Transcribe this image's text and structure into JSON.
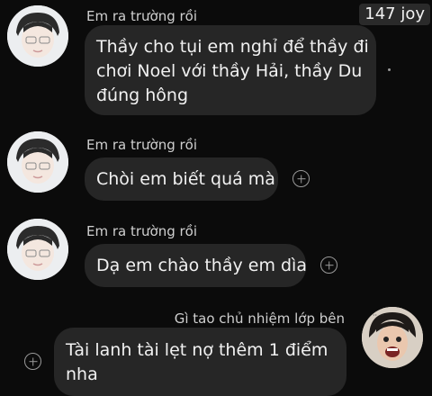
{
  "badge": {
    "text": "147 joy"
  },
  "messages": [
    {
      "sender": "Em ra trường rồi",
      "lines": [
        "Thầy cho tụi em nghỉ để thầy đi",
        "chơi Noel với thầy Hải, thầy Du",
        "đúng hông"
      ]
    },
    {
      "sender": "Em ra trường rồi",
      "lines": [
        "Chòi em biết quá mà"
      ]
    },
    {
      "sender": "Em ra trường rồi",
      "lines": [
        "Dạ em chào thầy em dìa"
      ]
    },
    {
      "sender": "Gì tao chủ nhiệm lớp bên",
      "lines": [
        "Tài lanh tài lẹt nợ thêm 1 điểm",
        "nha"
      ]
    }
  ]
}
